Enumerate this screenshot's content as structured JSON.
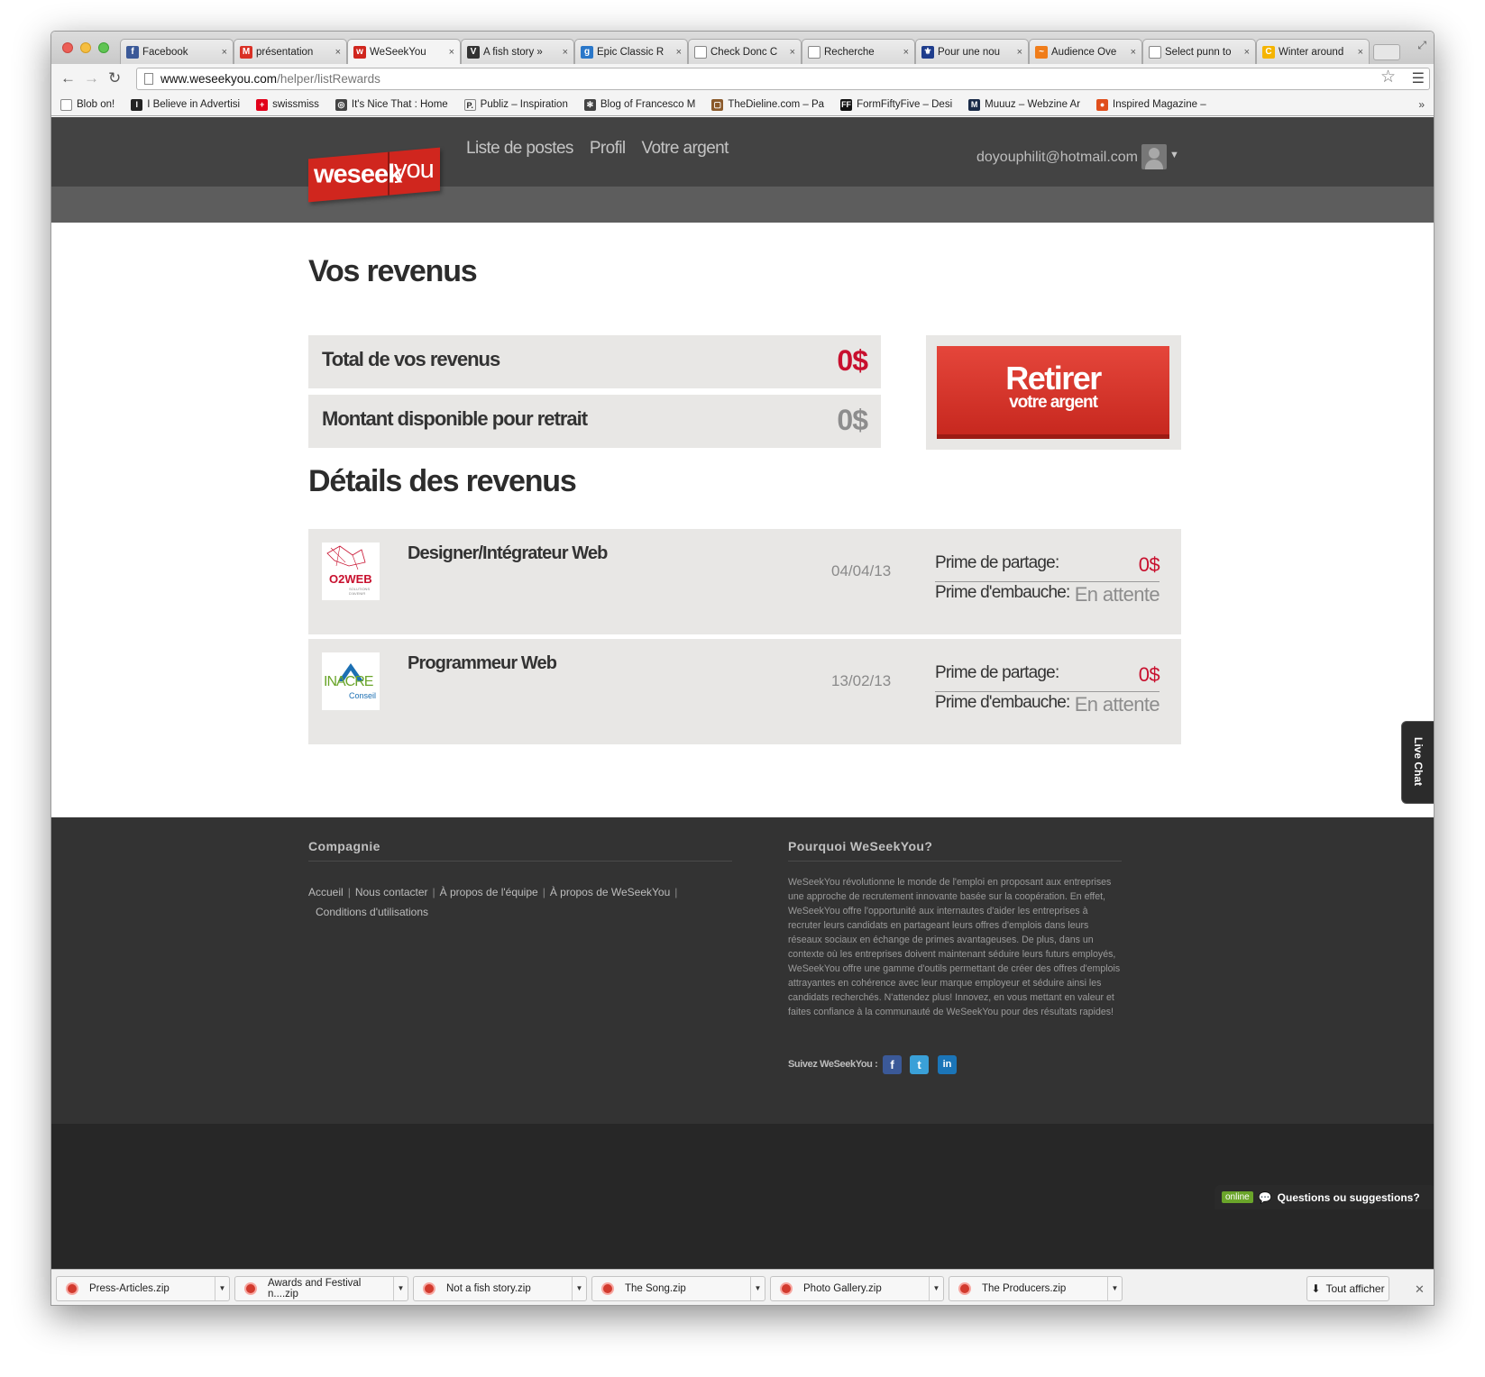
{
  "browser": {
    "tabs": [
      {
        "label": "Facebook",
        "color": "#3b5998",
        "glyph": "f"
      },
      {
        "label": "présentation",
        "color": "#d93025",
        "glyph": "M"
      },
      {
        "label": "WeSeekYou",
        "color": "#d0261e",
        "glyph": "w"
      },
      {
        "label": "A fish story »",
        "color": "#333333",
        "glyph": "V"
      },
      {
        "label": "Epic Classic R",
        "color": "#2a77c9",
        "glyph": "g"
      },
      {
        "label": "Check Donc C",
        "color": "#ffffff",
        "glyph": ""
      },
      {
        "label": "Recherche",
        "color": "#ffffff",
        "glyph": ""
      },
      {
        "label": "Pour une nou",
        "color": "#1f3d8c",
        "glyph": "⚜"
      },
      {
        "label": "Audience Ove",
        "color": "#f07d1a",
        "glyph": "~"
      },
      {
        "label": "Select punn to",
        "color": "#ffffff",
        "glyph": ""
      },
      {
        "label": "Winter around",
        "color": "#f5b400",
        "glyph": "C"
      }
    ],
    "url_host": "www.weseekyou.com",
    "url_path": "/helper/listRewards",
    "bookmarks": [
      {
        "label": "Blob on!",
        "color": "#ffffff",
        "glyph": ""
      },
      {
        "label": "I Believe in Advertisi",
        "color": "#222222",
        "glyph": "I"
      },
      {
        "label": "swissmiss",
        "color": "#e2001a",
        "glyph": "+"
      },
      {
        "label": "It's Nice That : Home",
        "color": "#444444",
        "glyph": "◎"
      },
      {
        "label": "Publiz – Inspiration",
        "color": "#f4f4f4",
        "glyph": "P."
      },
      {
        "label": "Blog of Francesco M",
        "color": "#444444",
        "glyph": "✻"
      },
      {
        "label": "TheDieline.com – Pa",
        "color": "#8b5a2b",
        "glyph": "▢"
      },
      {
        "label": "FormFiftyFive – Desi",
        "color": "#111111",
        "glyph": "FF"
      },
      {
        "label": "Muuuz – Webzine Ar",
        "color": "#1a2b48",
        "glyph": "M"
      },
      {
        "label": "Inspired Magazine –",
        "color": "#e04e1b",
        "glyph": "●"
      }
    ],
    "bookmarks_more": "»"
  },
  "site": {
    "logo_part1": "weseek",
    "logo_part2": "you",
    "nav": [
      "Liste de postes",
      "Profil",
      "Votre argent"
    ],
    "user_email": "doyouphilit@hotmail.com",
    "accent_red": "#c8102e"
  },
  "revenus": {
    "title": "Vos revenus",
    "total_label": "Total de vos revenus",
    "total_value": "0$",
    "available_label": "Montant disponible pour retrait",
    "available_value": "0$",
    "withdraw_main": "Retirer",
    "withdraw_sub": "votre argent"
  },
  "details": {
    "title": "Détails des revenus",
    "rows": [
      {
        "job": "Designer/Intégrateur Web",
        "date": "04/04/13",
        "logo_text": "O2WEB",
        "logo_sub": "SOLUTIONS D'AVENIR",
        "share_label": "Prime de partage:",
        "share_value": "0$",
        "hire_label": "Prime d'embauche:",
        "hire_value": "En attente"
      },
      {
        "job": "Programmeur Web",
        "date": "13/02/13",
        "logo_text": "INACRE",
        "logo_sub": "Conseil",
        "share_label": "Prime de partage:",
        "share_value": "0$",
        "hire_label": "Prime d'embauche:",
        "hire_value": "En attente"
      }
    ]
  },
  "footer": {
    "company_title": "Compagnie",
    "links": [
      "Accueil",
      "Nous contacter",
      "À propos de l'équipe",
      "À propos de WeSeekYou",
      "Conditions d'utilisations"
    ],
    "why_title": "Pourquoi WeSeekYou?",
    "why_text": "WeSeekYou révolutionne le monde de l'emploi en proposant aux entreprises une approche de recrutement innovante basée sur la coopération. En effet, WeSeekYou offre l'opportunité aux internautes d'aider les entreprises à recruter leurs candidats en partageant leurs offres d'emplois dans leurs réseaux sociaux en échange de primes avantageuses. De plus, dans un contexte où les entreprises doivent maintenant séduire leurs futurs employés, WeSeekYou offre une gamme d'outils permettant de créer des offres d'emplois attrayantes en cohérence avec leur marque employeur et séduire ainsi les candidats recherchés. N'attendez plus! Innovez, en vous mettant en valeur et faites confiance à la communauté de WeSeekYou pour des résultats rapides!",
    "follow_label": "Suivez WeSeekYou :"
  },
  "widgets": {
    "live_chat": "Live Chat",
    "online_badge": "online",
    "questions": "Questions ou suggestions?"
  },
  "downloads": {
    "items": [
      "Press-Articles.zip",
      "Awards and Festival n....zip",
      "Not a fish story.zip",
      "The Song.zip",
      "Photo Gallery.zip",
      "The Producers.zip"
    ],
    "show_all": "Tout afficher"
  }
}
